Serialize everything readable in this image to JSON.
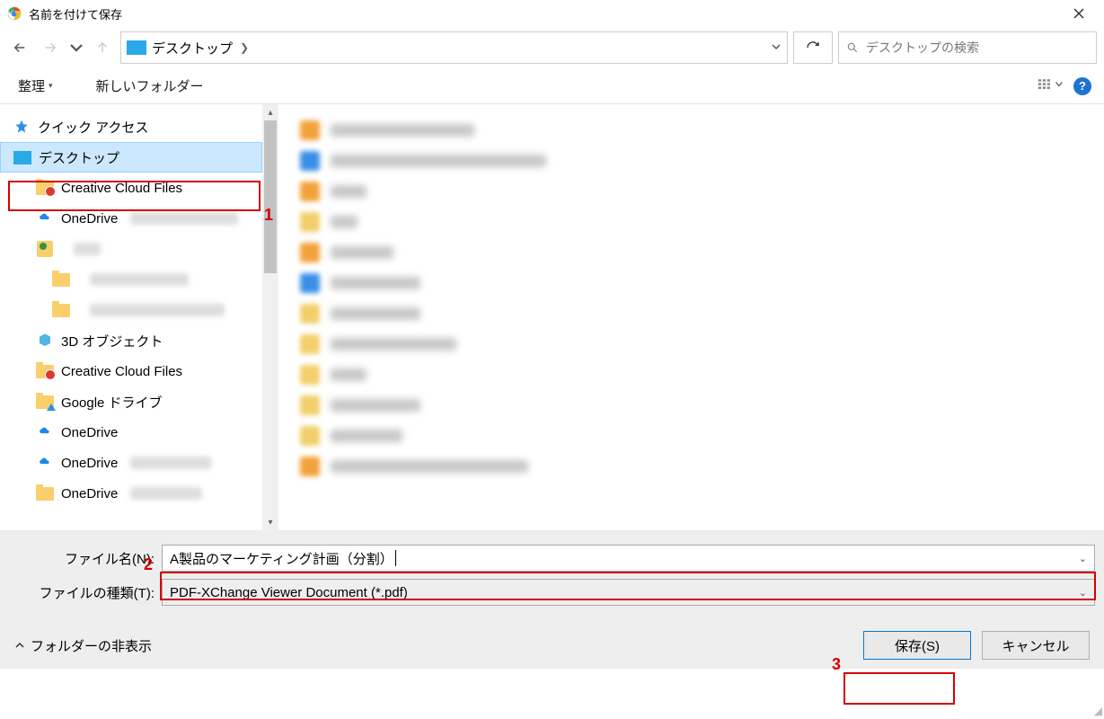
{
  "title": "名前を付けて保存",
  "breadcrumb": {
    "current": "デスクトップ"
  },
  "search": {
    "placeholder": "デスクトップの検索"
  },
  "toolbar": {
    "organize": "整理",
    "new_folder": "新しいフォルダー"
  },
  "tree": {
    "items": [
      {
        "label": "クイック アクセス",
        "icon": "star",
        "indent": 0
      },
      {
        "label": "デスクトップ",
        "icon": "desktop",
        "indent": 0,
        "selected": true
      },
      {
        "label": "Creative Cloud Files",
        "icon": "folder-cc",
        "indent": 1
      },
      {
        "label": "OneDrive",
        "icon": "onedrive",
        "indent": 1,
        "blur_ext": 120
      },
      {
        "label": "",
        "icon": "user",
        "indent": 1,
        "blur_ext": 30
      },
      {
        "label": "",
        "icon": "folder",
        "indent": 2,
        "blur_ext": 110
      },
      {
        "label": "",
        "icon": "folder",
        "indent": 2,
        "blur_ext": 150
      },
      {
        "label": "3D オブジェクト",
        "icon": "3d",
        "indent": 1
      },
      {
        "label": "Creative Cloud Files",
        "icon": "folder-cc",
        "indent": 1
      },
      {
        "label": "Google ドライブ",
        "icon": "folder-gd",
        "indent": 1
      },
      {
        "label": "OneDrive",
        "icon": "onedrive",
        "indent": 1
      },
      {
        "label": "OneDrive",
        "icon": "onedrive",
        "indent": 1,
        "blur_ext": 90
      },
      {
        "label": "OneDrive",
        "icon": "folder",
        "indent": 1,
        "blur_ext": 80
      }
    ]
  },
  "filelist": [
    {
      "icon_color": "#f2a23a",
      "name_w": 160
    },
    {
      "icon_color": "#3b8ee8",
      "name_w": 240
    },
    {
      "icon_color": "#f2a23a",
      "name_w": 40
    },
    {
      "icon_color": "#f2cf6a",
      "name_w": 30
    },
    {
      "icon_color": "#f2a23a",
      "name_w": 70
    },
    {
      "icon_color": "#3b8ee8",
      "name_w": 100
    },
    {
      "icon_color": "#f2cf6a",
      "name_w": 100
    },
    {
      "icon_color": "#f2cf6a",
      "name_w": 140
    },
    {
      "icon_color": "#f2cf6a",
      "name_w": 40
    },
    {
      "icon_color": "#f2cf6a",
      "name_w": 100
    },
    {
      "icon_color": "#f2cf6a",
      "name_w": 80
    },
    {
      "icon_color": "#f2a23a",
      "name_w": 220
    }
  ],
  "filename_label": "ファイル名(N):",
  "filename_value": "A製品のマーケティング計画（分割）",
  "filetype_label": "ファイルの種類(T):",
  "filetype_value": "PDF-XChange Viewer Document (*.pdf)",
  "hide_folders": "フォルダーの非表示",
  "save_btn": "保存(S)",
  "cancel_btn": "キャンセル",
  "annotations": {
    "1": "1",
    "2": "2",
    "3": "3"
  }
}
